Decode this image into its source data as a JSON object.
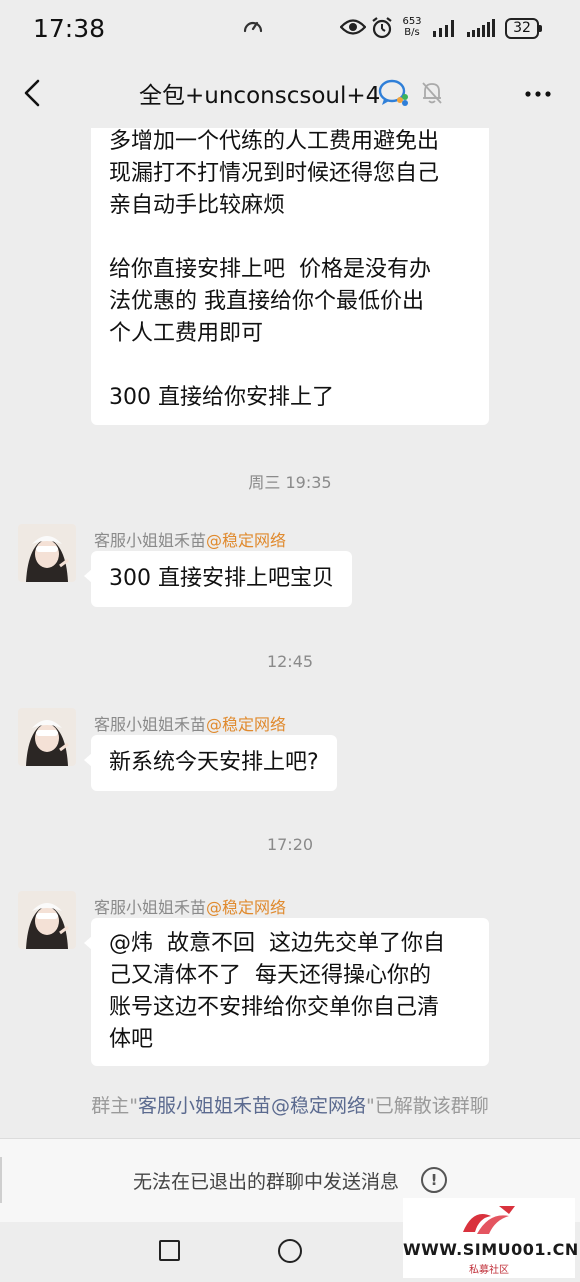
{
  "status_bar": {
    "time": "17:38",
    "net_speed_value": "653",
    "net_speed_unit": "B/s",
    "battery": "32"
  },
  "header": {
    "title": "全包+unconscsoul+4"
  },
  "messages": {
    "first_bubble": {
      "lines_a": [
        "多增加一个代练的人工费用避免出",
        "现漏打不打情况到时候还得您自己",
        "亲自动手比较麻烦"
      ],
      "lines_b": [
        "给你直接安排上吧  价格是没有办",
        "法优惠的 我直接给你个最低价出",
        "个人工费用即可"
      ],
      "lines_c": [
        "300 直接给你安排上了"
      ]
    },
    "ts1": "周三 19:35",
    "msg1": {
      "sender": "客服小姐姐禾苗",
      "tag": "@稳定网络",
      "text": "300 直接安排上吧宝贝"
    },
    "ts2": "12:45",
    "msg2": {
      "sender": "客服小姐姐禾苗",
      "tag": "@稳定网络",
      "text": "新系统今天安排上吧?"
    },
    "ts3": "17:20",
    "msg3": {
      "sender": "客服小姐姐禾苗",
      "tag": "@稳定网络",
      "lines": [
        "@炜  故意不回  这边先交单了你自",
        "己又清体不了  每天还得操心你的",
        "账号这边不安排给你交单你自己清",
        "体吧"
      ]
    },
    "system_notice": {
      "prefix": "群主\"",
      "link": "客服小姐姐禾苗@稳定网络",
      "suffix": "\"已解散该群聊"
    }
  },
  "input_bar": {
    "disabled_text": "无法在已退出的群聊中发送消息"
  },
  "watermark": {
    "url": "WWW.SIMU001.CN",
    "sub": "私募社区"
  },
  "colors": {
    "background": "#ededed",
    "bubble": "#ffffff",
    "tag": "#e08a2e",
    "link": "#5b6a8f"
  }
}
